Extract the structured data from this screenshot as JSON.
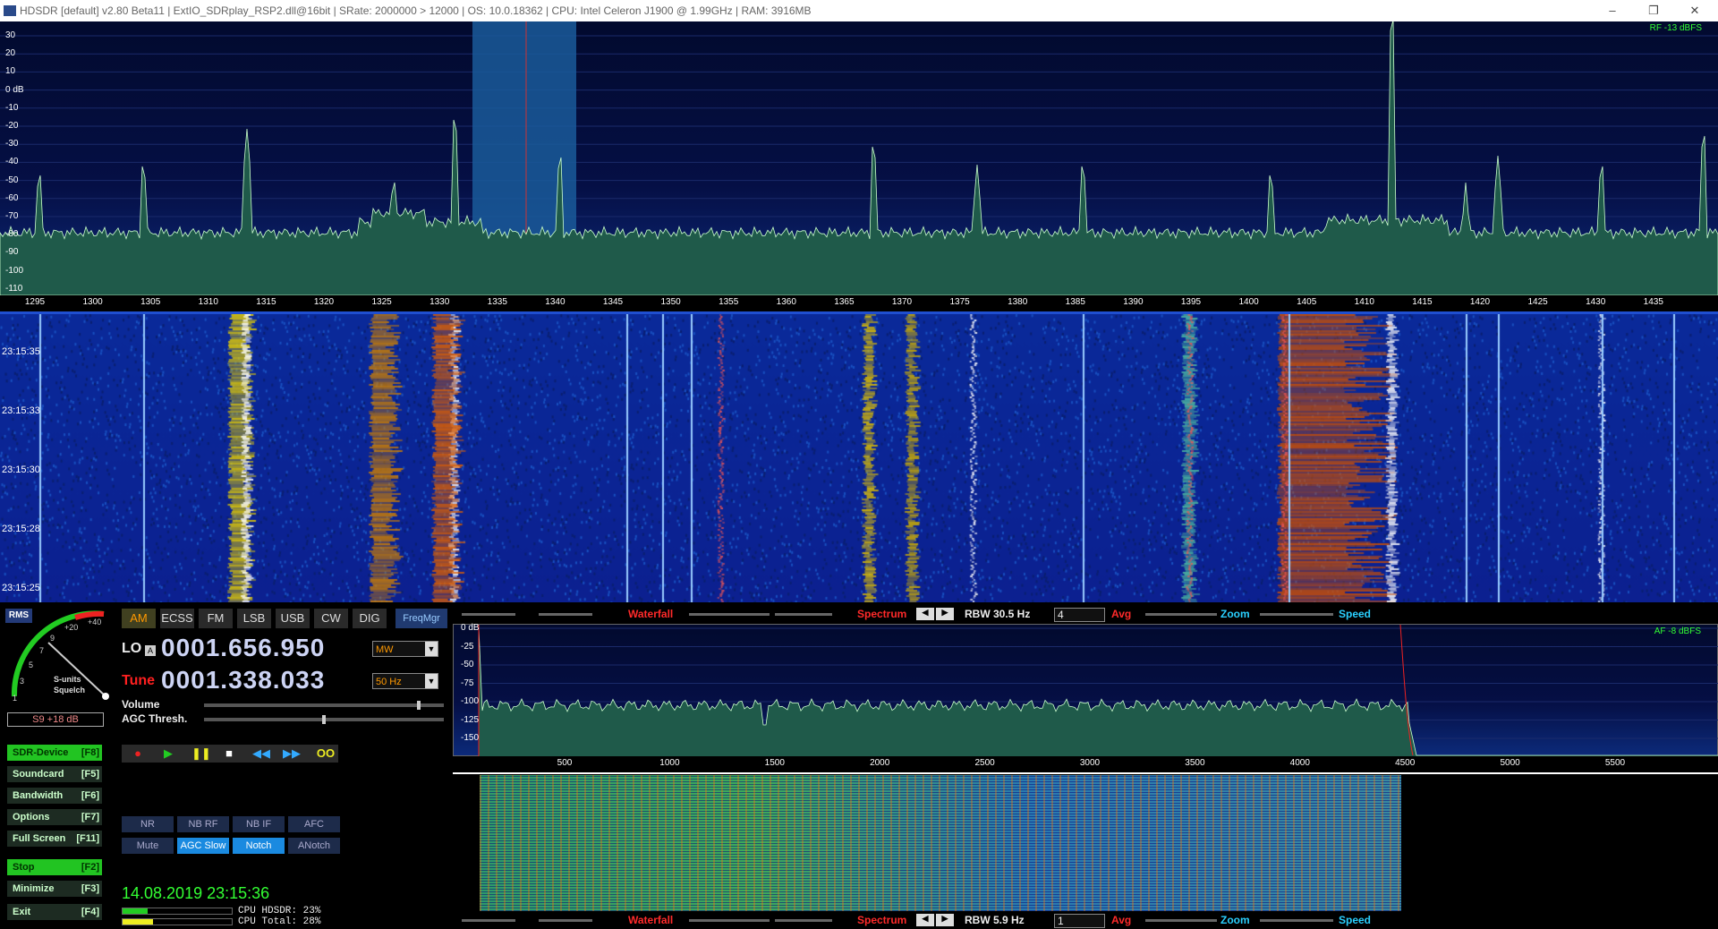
{
  "titlebar": {
    "title": "HDSDR  [default]  v2.80 Beta11  |  ExtIO_SDRplay_RSP2.dll@16bit  |  SRate: 2000000 > 12000  |  OS: 10.0.18362   |  CPU: Intel Celeron  J1900  @ 1.99GHz  |  RAM: 3916MB",
    "min": "–",
    "restore": "❐",
    "close": "✕"
  },
  "rf": {
    "level": "RF -13 dBFS",
    "db_labels": [
      "30",
      "20",
      "10",
      "0 dB",
      "-10",
      "-20",
      "-30",
      "-40",
      "-50",
      "-60",
      "-70",
      "-80",
      "-90",
      "-100",
      "-110"
    ],
    "freq_labels": [
      "1295",
      "1300",
      "1305",
      "1310",
      "1315",
      "1320",
      "1325",
      "1330",
      "1335",
      "1340",
      "1345",
      "1350",
      "1355",
      "1360",
      "1365",
      "1370",
      "1375",
      "1380",
      "1385",
      "1390",
      "1395",
      "1400",
      "1405",
      "1410",
      "1415",
      "1420",
      "1425",
      "1430",
      "1435"
    ],
    "time_labels": [
      "23:15:35",
      "23:15:33",
      "23:15:30",
      "23:15:28",
      "23:15:25"
    ]
  },
  "meter": {
    "rms": "RMS",
    "scale": [
      "1",
      "3",
      "5",
      "7",
      "9",
      "+20",
      "+40"
    ],
    "caption1": "S-units",
    "caption2": "Squelch",
    "reading": "S9 +18 dB"
  },
  "side_buttons": [
    {
      "label": "SDR-Device",
      "key": "[F8]",
      "on": true
    },
    {
      "label": "Soundcard",
      "key": "[F5]",
      "on": false
    },
    {
      "label": "Bandwidth",
      "key": "[F6]",
      "on": false
    },
    {
      "label": "Options",
      "key": "[F7]",
      "on": false
    },
    {
      "label": "Full Screen",
      "key": "[F11]",
      "on": false
    },
    {
      "label": "Stop",
      "key": "[F2]",
      "on": true
    },
    {
      "label": "Minimize",
      "key": "[F3]",
      "on": false
    },
    {
      "label": "Exit",
      "key": "[F4]",
      "on": false
    }
  ],
  "modes": [
    "AM",
    "ECSS",
    "FM",
    "LSB",
    "USB",
    "CW",
    "DIG"
  ],
  "freqmgr": "FreqMgr",
  "lo": {
    "label": "LO",
    "badge": "A",
    "value": "0001.656.950",
    "band": "MW"
  },
  "tune": {
    "label": "Tune",
    "value": "0001.338.033",
    "step": "50 Hz"
  },
  "volume": {
    "label": "Volume",
    "level": 0.9
  },
  "agc": {
    "label": "AGC Thresh.",
    "level": 0.5
  },
  "transport": [
    "●",
    "▶",
    "❚❚",
    "■",
    "◀◀",
    "▶▶",
    "OO"
  ],
  "dsp_row1": [
    "NR",
    "NB RF",
    "NB IF",
    "AFC"
  ],
  "dsp_row2": [
    "Mute",
    "AGC Slow",
    "Notch",
    "ANotch"
  ],
  "datetime": "14.08.2019 23:15:36",
  "cpu": {
    "hdsdr": "CPU HDSDR: 23%",
    "total": "CPU Total: 28%"
  },
  "ctrl_top": {
    "waterfall": "Waterfall",
    "spectrum": "Spectrum",
    "rbw": "RBW 30.5 Hz",
    "avg_val": "4",
    "avg": "Avg",
    "zoom": "Zoom",
    "speed": "Speed"
  },
  "ctrl_bottom": {
    "waterfall": "Waterfall",
    "spectrum": "Spectrum",
    "rbw": "RBW  5.9 Hz",
    "avg_val": "1",
    "avg": "Avg",
    "zoom": "Zoom",
    "speed": "Speed"
  },
  "af": {
    "level": "AF  -8 dBFS",
    "db_labels": [
      "0 dB",
      "-25",
      "-50",
      "-75",
      "-100",
      "-125",
      "-150"
    ],
    "freq_labels": [
      "500",
      "1000",
      "1500",
      "2000",
      "2500",
      "3000",
      "3500",
      "4000",
      "4500",
      "5000",
      "5500"
    ]
  },
  "colors": {
    "accent_green": "#22c422",
    "tune_red": "#ff2020",
    "waterfall_label": "#ff2a2a",
    "spectrum_label": "#ff2a2a",
    "speed_label": "#2ad0ff"
  }
}
